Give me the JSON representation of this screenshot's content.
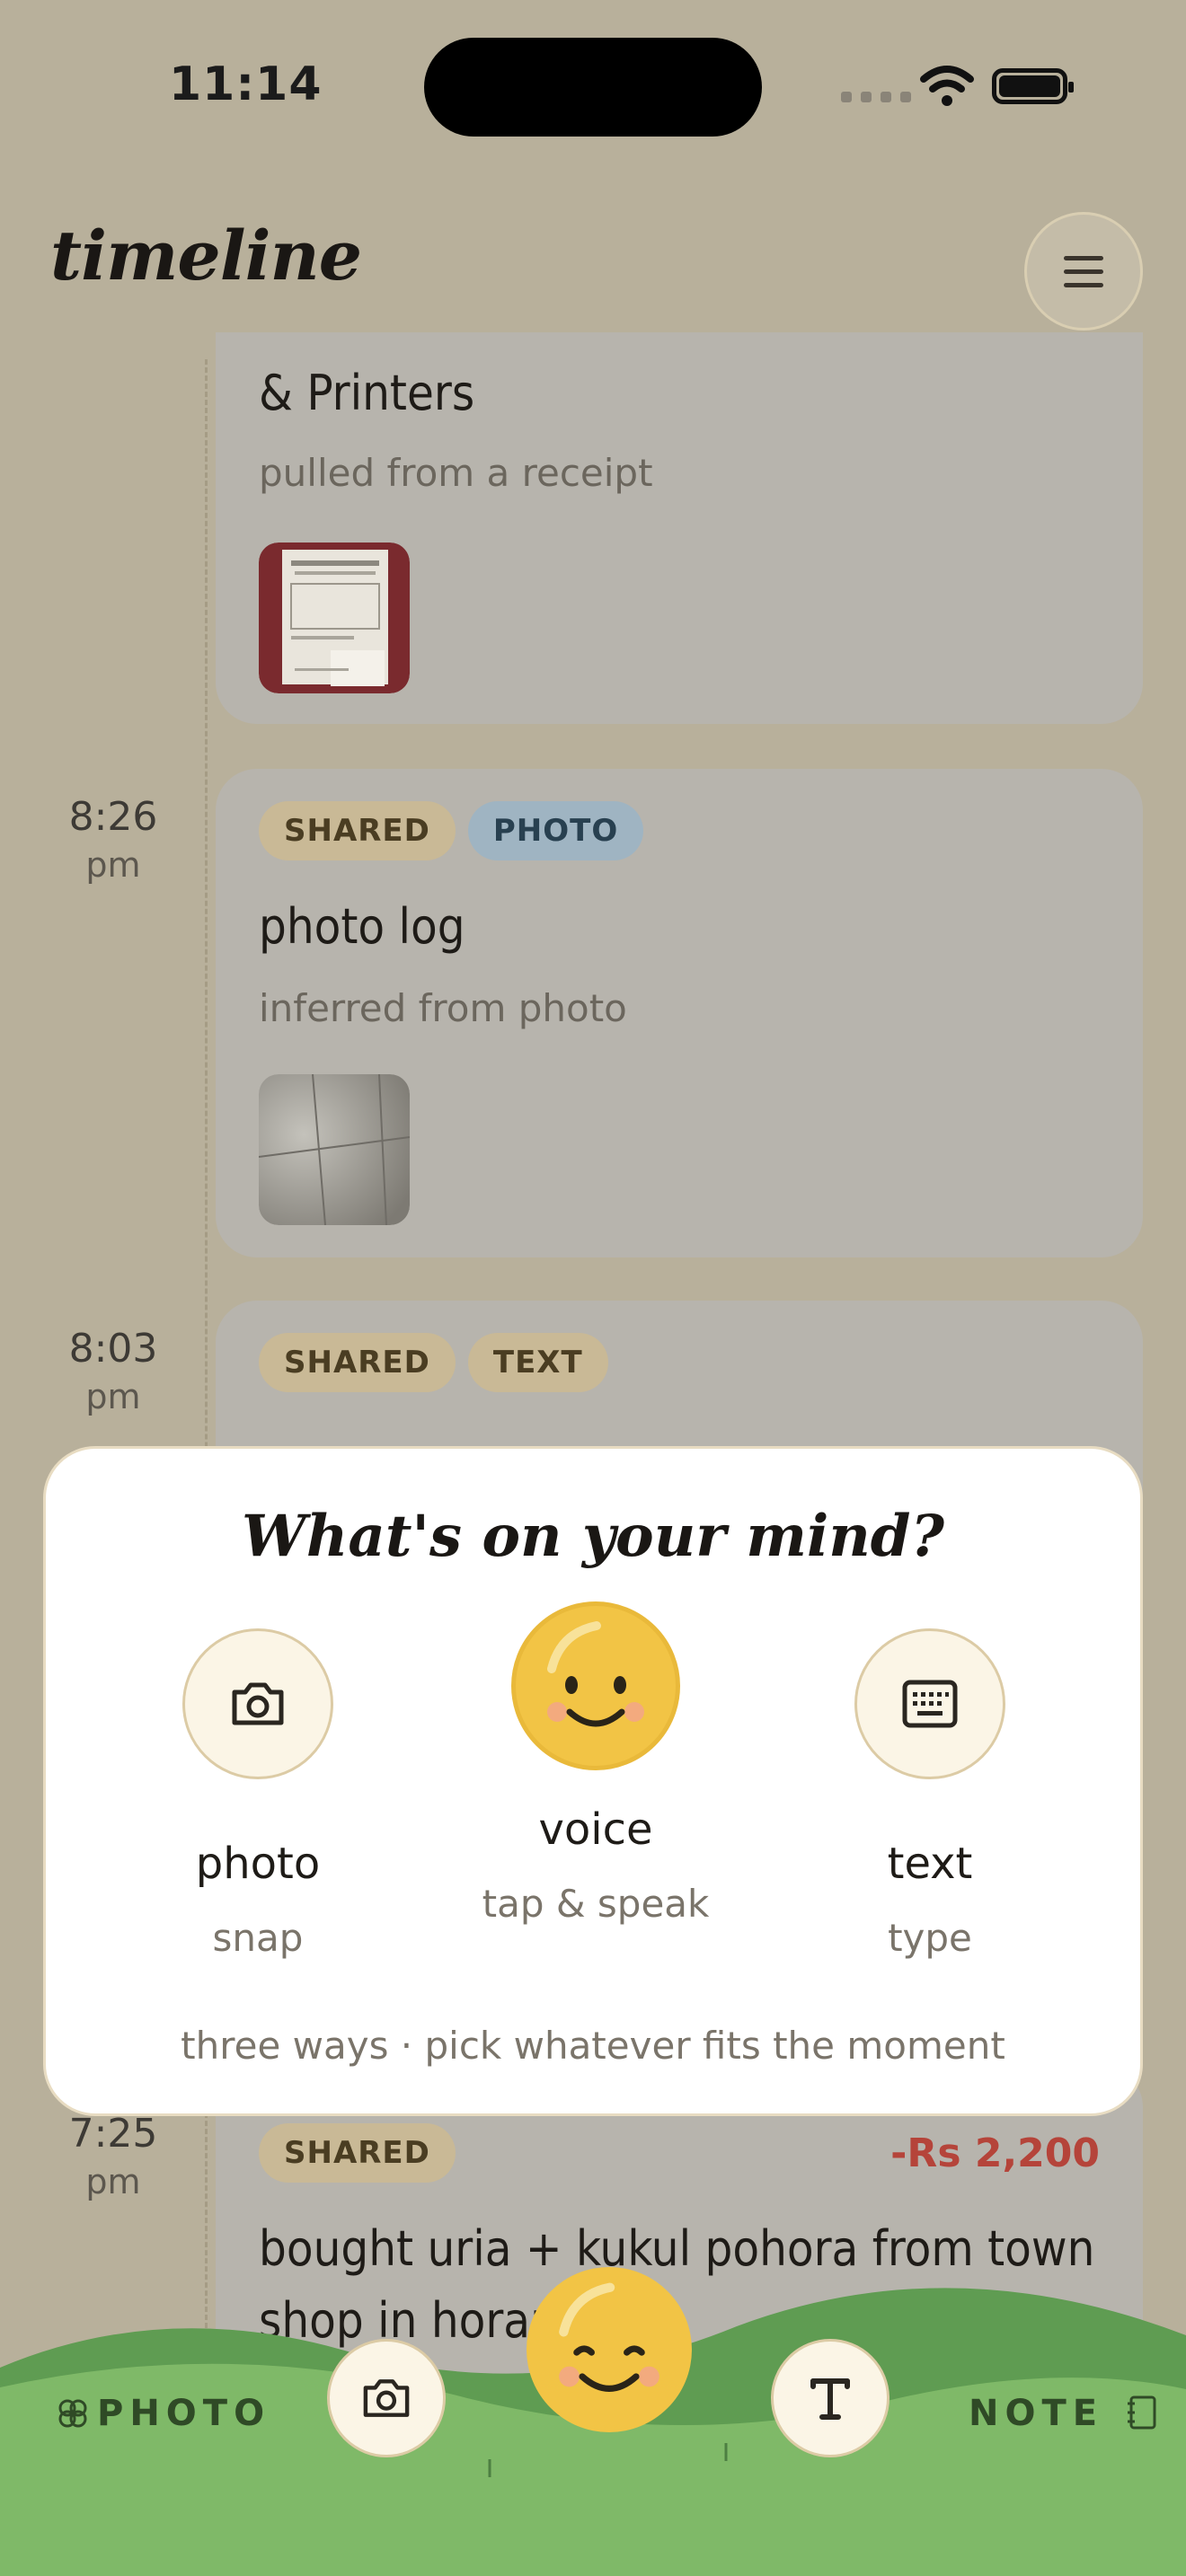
{
  "status_bar": {
    "time": "11:14"
  },
  "header": {
    "title": "timeline",
    "menu_icon": "hamburger-icon"
  },
  "timeline": {
    "entries": [
      {
        "title": "& Printers",
        "subtitle": "pulled from a receipt",
        "thumbnail": "receipt-photo"
      },
      {
        "time": "8:26",
        "ampm": "pm",
        "tags": [
          "SHARED",
          "PHOTO"
        ],
        "title": "photo log",
        "subtitle": "inferred from photo",
        "thumbnail": "floor-tile-photo"
      },
      {
        "time": "8:03",
        "ampm": "pm",
        "tags": [
          "SHARED",
          "TEXT"
        ]
      },
      {
        "time": "7:25",
        "ampm": "pm",
        "tags": [
          "SHARED"
        ],
        "amount": "-Rs 2,200",
        "title": "bought uria + kukul pohora from town shop in horana"
      }
    ]
  },
  "mind_prompt": {
    "title": "What's on your mind?",
    "options": [
      {
        "label": "photo",
        "sub": "snap",
        "icon": "camera-icon"
      },
      {
        "label": "voice",
        "sub": "tap & speak",
        "icon": "smiley-icon"
      },
      {
        "label": "text",
        "sub": "type",
        "icon": "keyboard-icon"
      }
    ],
    "footer": "three ways · pick whatever fits the moment"
  },
  "bottom_bar": {
    "left_label": "PHOTO",
    "right_label": "NOTE"
  },
  "colors": {
    "background": "#b8b09b",
    "card": "#b7b4ad",
    "accent_yellow": "#f2c445",
    "amount_red": "#b5443a",
    "grass_light": "#7fb968",
    "grass_dark": "#5f9c52"
  }
}
